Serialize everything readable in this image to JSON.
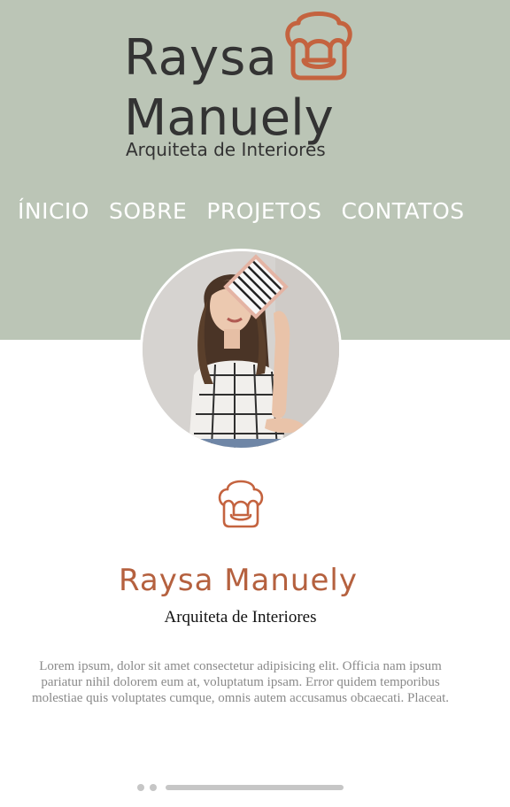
{
  "header": {
    "brand_line1": "Raysa",
    "brand_line2": "Manuely",
    "brand_tagline": "Arquiteta de Interiores",
    "logo_icon": "armchair-icon"
  },
  "nav": {
    "items": [
      {
        "label": "ÍNICIO"
      },
      {
        "label": "SOBRE"
      },
      {
        "label": "PROJETOS"
      },
      {
        "label": "CONTATOS"
      }
    ]
  },
  "profile": {
    "name": "Raysa Manuely",
    "role": "Arquiteta de Interiores",
    "about": "Lorem ipsum, dolor sit amet consectetur adipisicing elit. Officia nam ipsum pariatur nihil dolorem eum at, voluptatum ipsam. Error quidem temporibus molestiae quis voluptates cumque, omnis autem accusamus obcaecati. Placeat.",
    "icon": "armchair-icon"
  },
  "colors": {
    "hero_bg": "#bbc5b6",
    "accent": "#b5613f",
    "logo_orange": "#c4633f",
    "text_dark": "#333333",
    "text_muted": "#8a8a8a"
  },
  "pager": {
    "dots": 2
  }
}
